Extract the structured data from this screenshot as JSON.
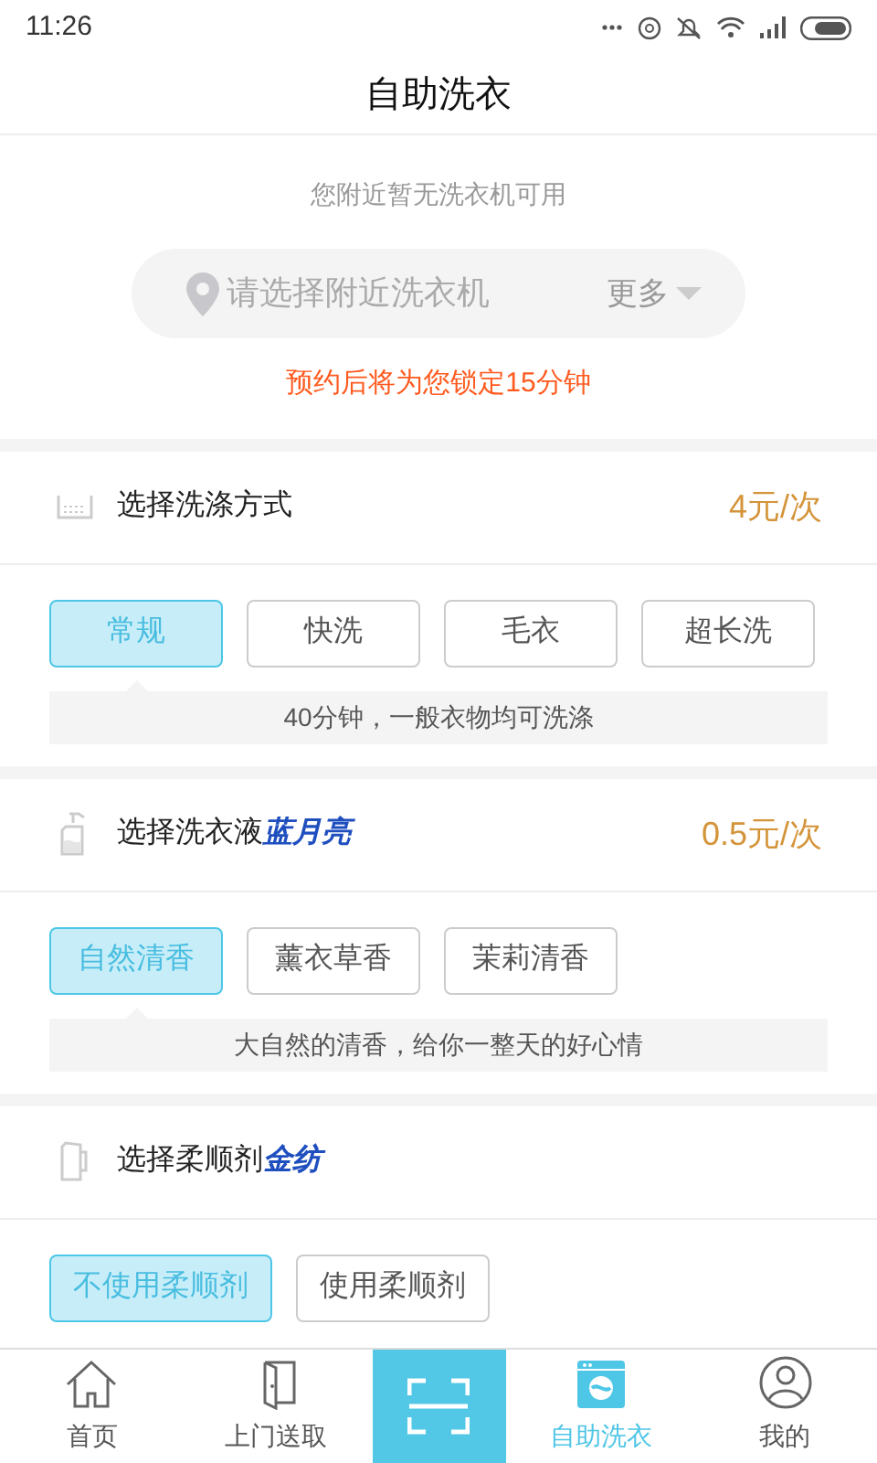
{
  "status_bar": {
    "time": "11:26"
  },
  "header": {
    "title": "自助洗衣"
  },
  "machine": {
    "notice": "您附近暂无洗衣机可用",
    "search": {
      "placeholder": "请选择附近洗衣机"
    },
    "more": "更多",
    "lock_hint": "预约后将为您锁定15分钟"
  },
  "sections": [
    {
      "kind": "basin",
      "title": "选择洗涤方式",
      "price": "4元/次",
      "options": [
        {
          "label": "常规",
          "selected": true
        },
        {
          "label": "快洗",
          "selected": false
        },
        {
          "label": "毛衣",
          "selected": false
        },
        {
          "label": "超长洗",
          "selected": false
        }
      ],
      "description": "40分钟，一般衣物均可洗涤"
    },
    {
      "kind": "bottle",
      "title": "选择洗衣液",
      "brand": "蓝月亮",
      "price": "0.5元/次",
      "options": [
        {
          "label": "自然清香",
          "selected": true
        },
        {
          "label": "薰衣草香",
          "selected": false
        },
        {
          "label": "茉莉清香",
          "selected": false
        }
      ],
      "description": "大自然的清香，给你一整天的好心情"
    },
    {
      "kind": "jug",
      "title": "选择柔顺剂",
      "brand": "金纺",
      "options": [
        {
          "label": "不使用柔顺剂",
          "selected": true
        },
        {
          "label": "使用柔顺剂",
          "selected": false
        }
      ]
    }
  ],
  "bottom_nav": [
    {
      "kind": "home",
      "label": "首页",
      "selected": false
    },
    {
      "kind": "door",
      "label": "上门送取",
      "selected": false
    },
    {
      "kind": "scan"
    },
    {
      "kind": "washer",
      "label": "自助洗衣",
      "selected": true
    },
    {
      "kind": "user",
      "label": "我的",
      "selected": false
    }
  ]
}
